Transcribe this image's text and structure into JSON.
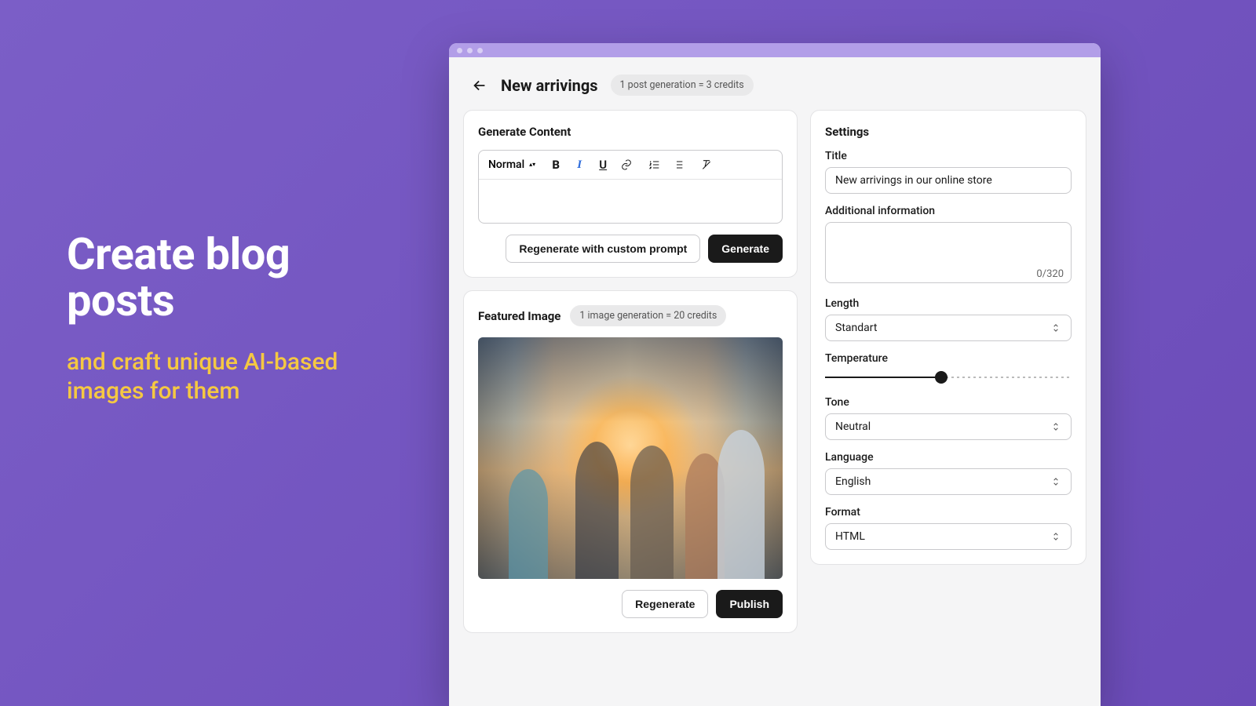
{
  "hero": {
    "title": "Create blog posts",
    "subtitle": "and craft unique AI-based images for them"
  },
  "topbar": {
    "page_title": "New arrivings",
    "credits_badge": "1 post generation = 3 credits"
  },
  "content": {
    "heading": "Generate Content",
    "format_selector": "Normal",
    "regenerate_label": "Regenerate with custom prompt",
    "generate_label": "Generate"
  },
  "featured": {
    "heading": "Featured Image",
    "credits_badge": "1 image generation = 20 credits",
    "regenerate_label": "Regenerate",
    "publish_label": "Publish"
  },
  "settings": {
    "heading": "Settings",
    "title_label": "Title",
    "title_value": "New arrivings in our online store",
    "additional_label": "Additional information",
    "additional_value": "",
    "char_count": "0/320",
    "length_label": "Length",
    "length_value": "Standart",
    "temperature_label": "Temperature",
    "tone_label": "Tone",
    "tone_value": "Neutral",
    "language_label": "Language",
    "language_value": "English",
    "format_label": "Format",
    "format_value": "HTML"
  }
}
